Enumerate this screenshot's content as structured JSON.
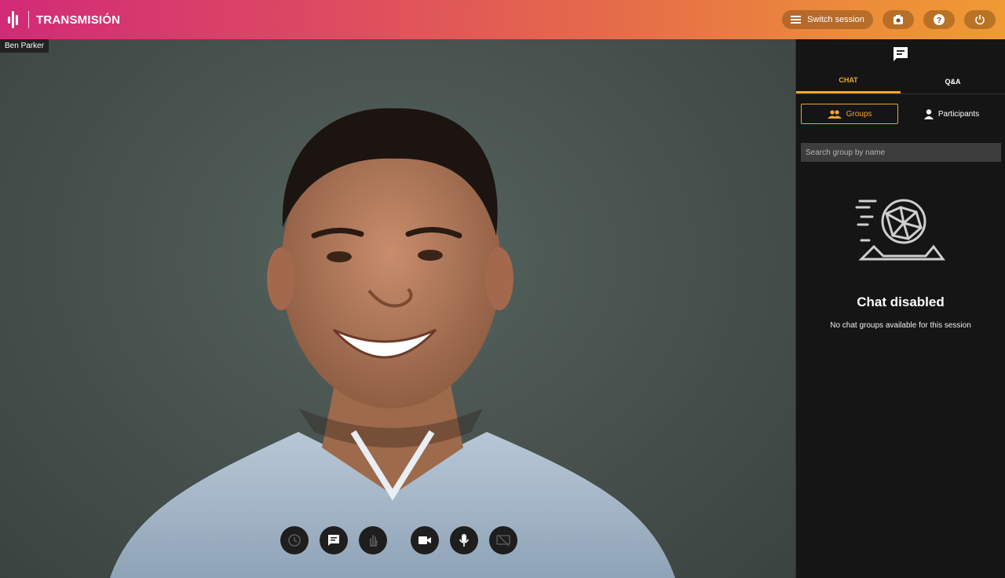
{
  "app": {
    "title": "TRANSMISIÓN"
  },
  "header": {
    "switch_session_label": "Switch session",
    "icons": [
      "menu-icon",
      "camera-switch-icon",
      "help-icon",
      "power-icon"
    ]
  },
  "video": {
    "participant_name": "Ben Parker"
  },
  "controls": [
    {
      "name": "clock-button",
      "icon": "clock-icon",
      "enabled": false
    },
    {
      "name": "chat-button",
      "icon": "chat-icon",
      "enabled": true
    },
    {
      "name": "raise-hand-button",
      "icon": "hand-icon",
      "enabled": false
    },
    {
      "name": "camera-button",
      "icon": "video-camera-icon",
      "enabled": true
    },
    {
      "name": "microphone-button",
      "icon": "microphone-icon",
      "enabled": true
    },
    {
      "name": "screen-share-button",
      "icon": "screen-share-off-icon",
      "enabled": false
    }
  ],
  "sidebar": {
    "tabs": [
      {
        "label": "CHAT",
        "active": true
      },
      {
        "label": "Q&A",
        "active": false
      }
    ],
    "subtabs": [
      {
        "label": "Groups",
        "active": true
      },
      {
        "label": "Participants",
        "active": false
      }
    ],
    "search": {
      "placeholder": "Search group by name",
      "value": ""
    },
    "empty_state": {
      "title": "Chat disabled",
      "subtitle": "No chat groups available for this session"
    }
  },
  "colors": {
    "accent": "#f0a62c",
    "sidebar_bg": "#151515",
    "topbar_start": "#d22a78",
    "topbar_end": "#ef9a33"
  }
}
